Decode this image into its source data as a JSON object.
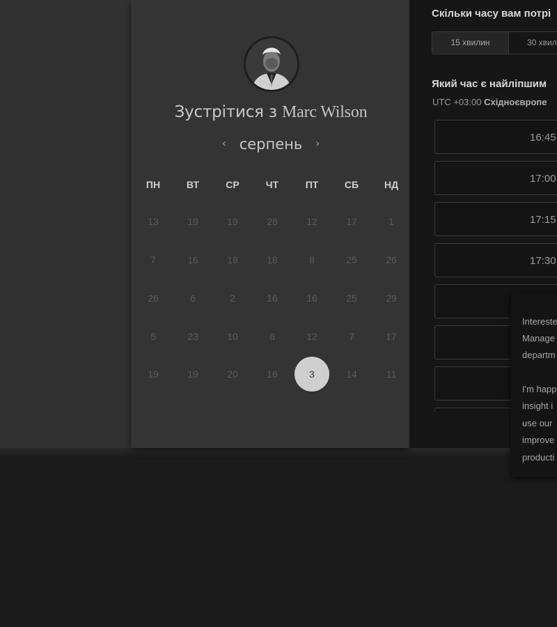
{
  "card": {
    "title_prefix": "Зустрітися з",
    "host_name": "Marc Wilson",
    "month": "серпень",
    "prev_arrow": "‹",
    "next_arrow": "›",
    "weekdays": [
      "ПН",
      "ВТ",
      "СР",
      "ЧТ",
      "ПТ",
      "СБ",
      "НД"
    ],
    "weeks": [
      [
        "13",
        "19",
        "19",
        "28",
        "12",
        "17",
        "1"
      ],
      [
        "7",
        "16",
        "18",
        "18",
        "8",
        "25",
        "26"
      ],
      [
        "26",
        "6",
        "2",
        "16",
        "16",
        "25",
        "29"
      ],
      [
        "5",
        "23",
        "10",
        "6",
        "12",
        "7",
        "17"
      ],
      [
        "19",
        "19",
        "20",
        "16",
        "3",
        "14",
        "11"
      ]
    ],
    "selected_day": "3"
  },
  "panel": {
    "duration_question": "Скільки часу вам потрі",
    "durations": [
      "15 хвилин",
      "30 хвил"
    ],
    "time_question": "Який час є найліпшим",
    "tz_offset": "UTC +03:00",
    "tz_name": "Східноєвропе",
    "slots": [
      "16:45",
      "17:00",
      "17:15",
      "17:30",
      "",
      "",
      "",
      ""
    ]
  },
  "popup": {
    "line1": "Intereste",
    "line2": "Manage",
    "line3": "departm",
    "line4": "I'm happ",
    "line5": "insight i",
    "line6": "use our",
    "line7": "improve",
    "line8": "producti"
  },
  "colors": {
    "background": "#1b1b1b",
    "card": "#343434",
    "panel": "#161616",
    "selected_day": "#cfcfcf"
  }
}
